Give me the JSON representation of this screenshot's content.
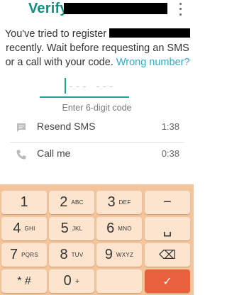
{
  "header": {
    "title": "Verify"
  },
  "message": {
    "line1": "You've tried to register",
    "line2": "recently. Wait before requesting an SMS",
    "line3_prefix": "or a call with your code.",
    "wrong_number_link": "Wrong number?"
  },
  "code_input": {
    "placeholder": "--- ---",
    "hint": "Enter 6-digit code"
  },
  "options": [
    {
      "label": "Resend SMS",
      "timer": "1:38",
      "icon": "message-icon"
    },
    {
      "label": "Call me",
      "timer": "0:38",
      "icon": "phone-icon"
    }
  ],
  "keypad": {
    "keys": [
      {
        "main": "1",
        "sub": ""
      },
      {
        "main": "2",
        "sub": "ABC"
      },
      {
        "main": "3",
        "sub": "DEF"
      },
      {
        "main": "−",
        "sub": ""
      },
      {
        "main": "4",
        "sub": "GHI"
      },
      {
        "main": "5",
        "sub": "JKL"
      },
      {
        "main": "6",
        "sub": "MNO"
      },
      {
        "main": "␣",
        "sub": ""
      },
      {
        "main": "7",
        "sub": "PQRS"
      },
      {
        "main": "8",
        "sub": "TUV"
      },
      {
        "main": "9",
        "sub": "WXYZ"
      },
      {
        "main": "⌫",
        "sub": ""
      },
      {
        "main": "* #",
        "sub": ""
      },
      {
        "main": "0",
        "sub": "+"
      },
      {
        "main": "",
        "sub": ""
      },
      {
        "main": "✓",
        "sub": ""
      }
    ]
  },
  "colors": {
    "accent": "#0f8e7e",
    "link": "#31a9c9",
    "keypad_bg": "#f3c59c",
    "key_bg": "#fde4cf",
    "done_key": "#e9603d"
  }
}
